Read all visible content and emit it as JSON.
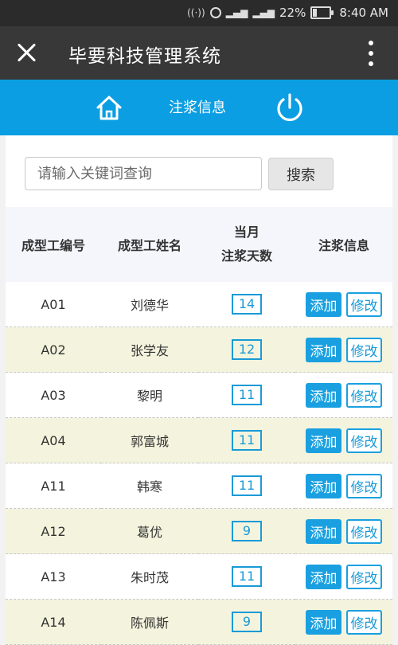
{
  "status_bar": {
    "battery": "22%",
    "time": "8:40 AM",
    "icons": [
      "hotspot-icon",
      "alarm-icon",
      "signal-icon",
      "signal-icon",
      "battery-icon"
    ]
  },
  "appbar": {
    "title": "毕要科技管理系统"
  },
  "nav": {
    "label": "注浆信息"
  },
  "search": {
    "placeholder": "请输入关键词查询",
    "button": "搜索"
  },
  "table": {
    "headers": {
      "code": "成型工编号",
      "name": "成型工姓名",
      "days_line1": "当月",
      "days_line2": "注浆天数",
      "info": "注浆信息"
    },
    "add_label": "添加",
    "edit_label": "修改",
    "rows": [
      {
        "code": "A01",
        "name": "刘德华",
        "days": "14"
      },
      {
        "code": "A02",
        "name": "张学友",
        "days": "12"
      },
      {
        "code": "A03",
        "name": "黎明",
        "days": "11"
      },
      {
        "code": "A04",
        "name": "郭富城",
        "days": "11"
      },
      {
        "code": "A11",
        "name": "韩寒",
        "days": "11"
      },
      {
        "code": "A12",
        "name": "葛优",
        "days": "9"
      },
      {
        "code": "A13",
        "name": "朱时茂",
        "days": "11"
      },
      {
        "code": "A14",
        "name": "陈佩斯",
        "days": "9"
      }
    ]
  },
  "colors": {
    "status_bar": "#2b2b2b",
    "app_bar": "#383838",
    "accent": "#0b9ee2",
    "alt_row": "#f4f4de"
  }
}
